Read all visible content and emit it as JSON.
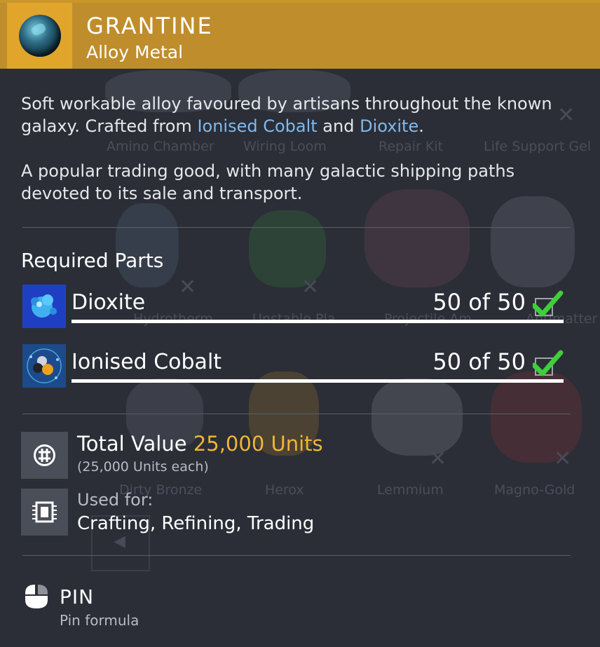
{
  "item": {
    "name": "GRANTINE",
    "category": "Alloy Metal",
    "icon": "grantine-ore-icon"
  },
  "description": {
    "line1_pre": "Soft workable alloy favoured by artisans throughout the known galaxy. Crafted from ",
    "link1": "Ionised Cobalt",
    "mid": " and ",
    "link2": "Dioxite",
    "end": ".",
    "para2": "A popular trading good, with many galactic shipping paths devoted to its sale and transport."
  },
  "required_parts": {
    "title": "Required Parts",
    "items": [
      {
        "name": "Dioxite",
        "count": "50 of 50",
        "icon": "dioxite-icon",
        "complete": true
      },
      {
        "name": "Ionised Cobalt",
        "count": "50 of 50",
        "icon": "ionised-cobalt-icon",
        "complete": true
      }
    ]
  },
  "value": {
    "label": "Total Value",
    "amount": "25,000 Units",
    "each": "(25,000 Units each)",
    "icon": "units-currency-icon"
  },
  "used_for": {
    "label": "Used for:",
    "value": "Crafting, Refining, Trading",
    "icon": "chip-icon"
  },
  "pin": {
    "label": "PIN",
    "sub": "Pin formula",
    "icon": "mouse-icon"
  },
  "background": {
    "labels": [
      "Amino Chamber",
      "Wiring Loom",
      "Repair Kit",
      "Life Support Gel",
      "Hydrotherm",
      "Unstable Pla",
      "Projectile Am",
      "Antimatter H",
      "Dirty Bronze",
      "Herox",
      "Lemmium",
      "Magno-Gold"
    ]
  },
  "colors": {
    "header": "#bf8d2c",
    "accent": "#e2a52c",
    "link": "#7fb9ec",
    "value": "#f0b533",
    "check": "#3fcf3a"
  }
}
